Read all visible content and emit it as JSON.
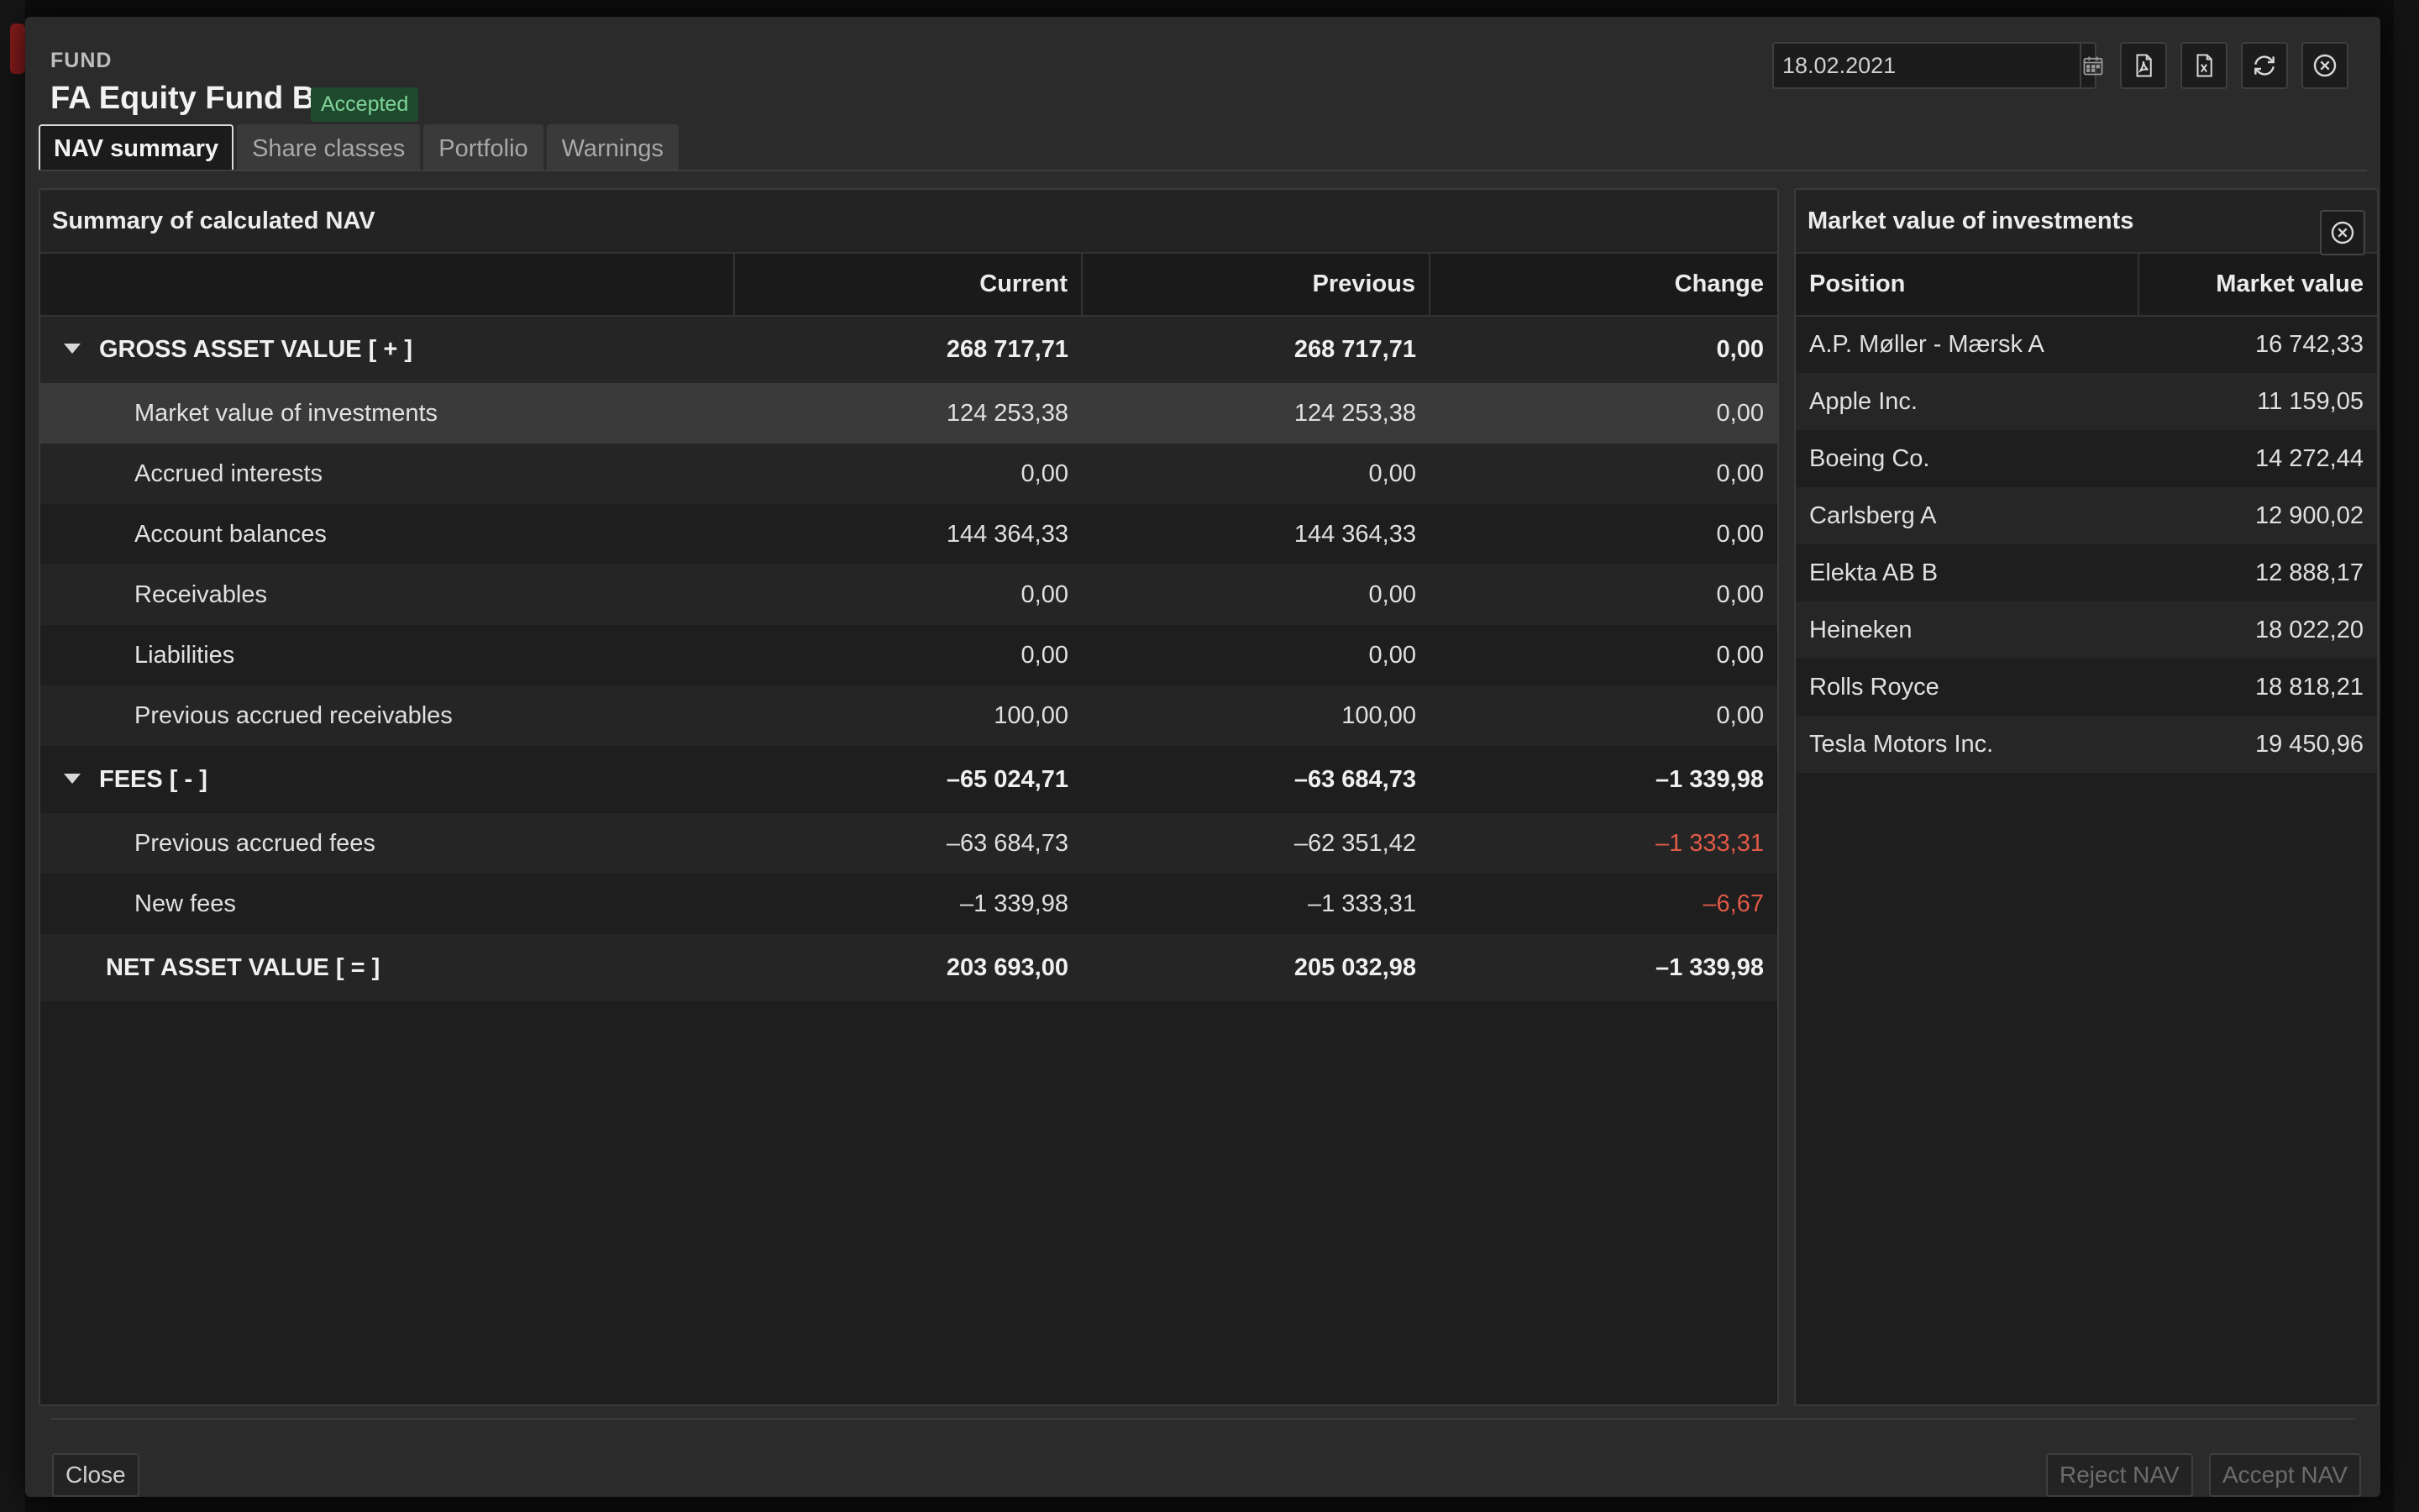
{
  "header": {
    "kicker": "FUND",
    "title": "FA Equity Fund B",
    "status": "Accepted",
    "date_value": "18.02.2021"
  },
  "toolbar_icons": [
    "calendar-icon",
    "pdf-export-icon",
    "excel-export-icon",
    "refresh-icon",
    "close-circle-icon"
  ],
  "tabs": [
    {
      "label": "NAV summary",
      "active": true
    },
    {
      "label": "Share classes"
    },
    {
      "label": "Portfolio"
    },
    {
      "label": "Warnings"
    }
  ],
  "nav_summary": {
    "title": "Summary of calculated NAV",
    "columns": [
      "",
      "Current",
      "Previous",
      "Change"
    ],
    "rows": [
      {
        "label": "GROSS ASSET VALUE [ + ]",
        "current": "268 717,71",
        "previous": "268 717,71",
        "change": "0,00"
      },
      {
        "label": "Market value of investments",
        "current": "124 253,38",
        "previous": "124 253,38",
        "change": "0,00"
      },
      {
        "label": "Accrued interests",
        "current": "0,00",
        "previous": "0,00",
        "change": "0,00"
      },
      {
        "label": "Account balances",
        "current": "144 364,33",
        "previous": "144 364,33",
        "change": "0,00"
      },
      {
        "label": "Receivables",
        "current": "0,00",
        "previous": "0,00",
        "change": "0,00"
      },
      {
        "label": "Liabilities",
        "current": "0,00",
        "previous": "0,00",
        "change": "0,00"
      },
      {
        "label": "Previous accrued receivables",
        "current": "100,00",
        "previous": "100,00",
        "change": "0,00"
      },
      {
        "label": "FEES [ - ]",
        "current": "–65 024,71",
        "previous": "–63 684,73",
        "change": "–1 339,98"
      },
      {
        "label": "Previous accrued fees",
        "current": "–63 684,73",
        "previous": "–62 351,42",
        "change": "–1 333,31"
      },
      {
        "label": "New fees",
        "current": "–1 339,98",
        "previous": "–1 333,31",
        "change": "–6,67"
      },
      {
        "label": "NET ASSET VALUE [ = ]",
        "current": "203 693,00",
        "previous": "205 032,98",
        "change": "–1 339,98"
      }
    ]
  },
  "market_value": {
    "title": "Market value of investments",
    "columns": [
      "Position",
      "Market value"
    ],
    "rows": [
      {
        "position": "A.P. Møller - Mærsk A",
        "value": "16 742,33"
      },
      {
        "position": "Apple Inc.",
        "value": "11 159,05"
      },
      {
        "position": "Boeing Co.",
        "value": "14 272,44"
      },
      {
        "position": "Carlsberg A",
        "value": "12 900,02"
      },
      {
        "position": "Elekta AB B",
        "value": "12 888,17"
      },
      {
        "position": "Heineken",
        "value": "18 022,20"
      },
      {
        "position": "Rolls Royce",
        "value": "18 818,21"
      },
      {
        "position": "Tesla Motors Inc.",
        "value": "19 450,96"
      }
    ]
  },
  "footer": {
    "close_label": "Close",
    "reject_label": "Reject NAV",
    "accept_label": "Accept NAV"
  },
  "colors": {
    "negative": "#e05a47",
    "accepted_bg": "#1f4a2d",
    "accepted_fg": "#7fd49a"
  }
}
